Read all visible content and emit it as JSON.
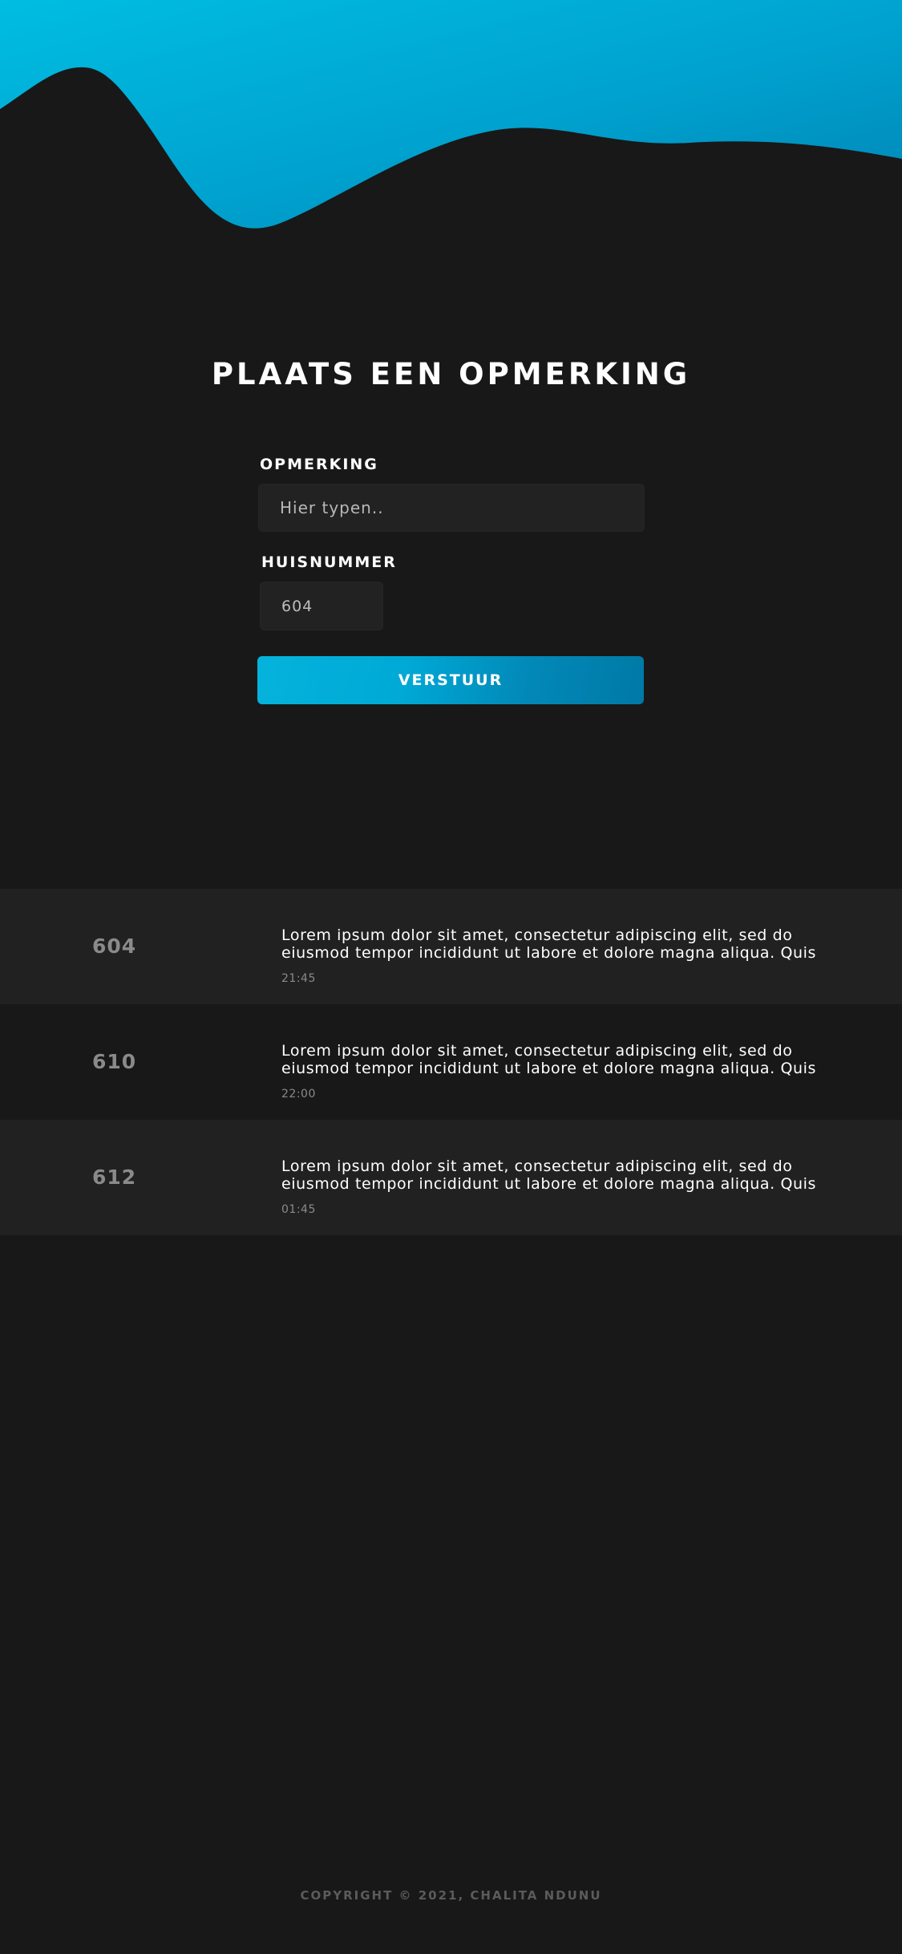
{
  "page": {
    "title": "PLAATS EEN OPMERKING"
  },
  "colors": {
    "background": "#181818",
    "wave_start": "#00bde2",
    "wave_end": "#0184b4",
    "button_start": "#04b3dc",
    "button_end": "#0079a6",
    "input_background": "#222222",
    "row_shaded": "#212121",
    "muted_text": "#8a8a8a"
  },
  "form": {
    "comment_label": "OPMERKING",
    "comment_placeholder": "Hier typen..",
    "house_number_label": "HUISNUMMER",
    "house_number_value": "604",
    "submit_label": "VERSTUUR"
  },
  "comments": [
    {
      "number": "604",
      "text": "Lorem ipsum dolor sit amet, consectetur adipiscing elit, sed do\neiusmod tempor incididunt ut labore et dolore magna aliqua. Quis",
      "time": "21:45"
    },
    {
      "number": "610",
      "text": "Lorem ipsum dolor sit amet, consectetur adipiscing elit, sed do\neiusmod tempor incididunt ut labore et dolore magna aliqua. Quis",
      "time": "22:00"
    },
    {
      "number": "612",
      "text": "Lorem ipsum dolor sit amet, consectetur adipiscing elit, sed do\neiusmod tempor incididunt ut labore et dolore magna aliqua. Quis",
      "time": "01:45"
    }
  ],
  "footer": {
    "copyright": "COPYRIGHT © 2021, CHALITA NDUNU"
  }
}
